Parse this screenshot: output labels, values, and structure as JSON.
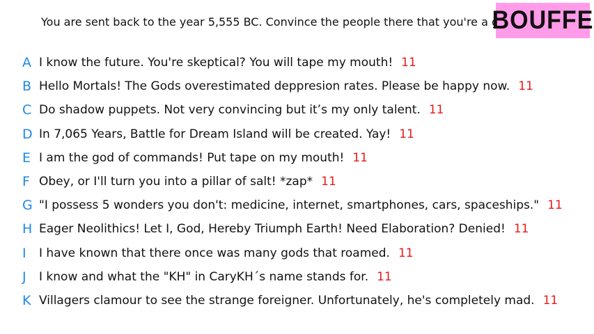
{
  "prompt": "You are sent back to the year 5,555 BC. Convince the people there that you're a god.",
  "badge": {
    "label": "BOUFFE",
    "color": "#ff9be8"
  },
  "colors": {
    "letter": "#1e88e5",
    "score": "#e61a1a",
    "text": "#111111"
  },
  "responses": [
    {
      "letter": "A",
      "text": "I know the future. You're skeptical? You will tape my mouth!",
      "score": "11"
    },
    {
      "letter": "B",
      "text": "Hello Mortals! The Gods overestimated deppresion rates. Please be happy now.",
      "score": "11"
    },
    {
      "letter": "C",
      "text": "Do shadow puppets. Not very convincing but it’s my only talent.",
      "score": "11"
    },
    {
      "letter": "D",
      "text": "In 7,065 Years, Battle for Dream Island will be created. Yay!",
      "score": "11"
    },
    {
      "letter": "E",
      "text": "I am the god of commands! Put tape on my mouth!",
      "score": "11"
    },
    {
      "letter": "F",
      "text": "Obey, or I'll turn you into a pillar of salt! *zap*",
      "score": "11"
    },
    {
      "letter": "G",
      "text": "\"I possess 5 wonders you don't: medicine, internet, smartphones, cars, spaceships.\"",
      "score": "11"
    },
    {
      "letter": "H",
      "text": "Eager Neolithics! Let I, God, Hereby Triumph Earth! Need Elaboration? Denied!",
      "score": "11"
    },
    {
      "letter": "I",
      "text": "I have known that there once was many gods that roamed.",
      "score": "11"
    },
    {
      "letter": "J",
      "text": "I know and what the \"KH\" in CaryKH´s name stands for.",
      "score": "11"
    },
    {
      "letter": "K",
      "text": "Villagers clamour to see the strange foreigner. Unfortunately, he's completely mad.",
      "score": "11"
    }
  ]
}
